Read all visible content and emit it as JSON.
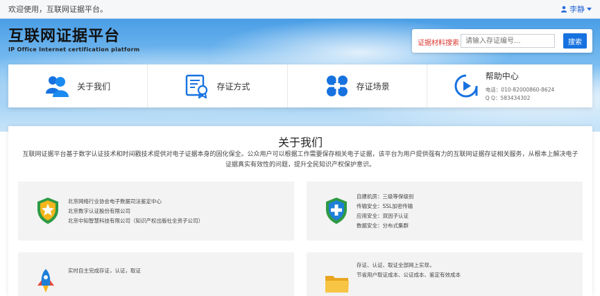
{
  "topbar": {
    "welcome": "欢迎使用，互联网证据平台。",
    "username": "李静",
    "user_icon": "user-icon",
    "caret_icon": "caret-down-icon"
  },
  "logo": {
    "title": "互联网证据平台",
    "subtitle": "IP Office Internet certification platform"
  },
  "search": {
    "label": "证据材料搜索：",
    "placeholder": "请输入存证编号...",
    "button": "搜索"
  },
  "nav": {
    "items": [
      {
        "label": "关于我们",
        "icon": "users-icon"
      },
      {
        "label": "存证方式",
        "icon": "certificate-icon"
      },
      {
        "label": "存证场景",
        "icon": "grid-icon"
      }
    ],
    "help": {
      "title": "帮助中心",
      "phone": "电话：010-82000860-8624",
      "qq": "Q  Q：583434302",
      "icon": "play-icon"
    }
  },
  "about": {
    "title": "关于我们",
    "description": "互联网证据平台基于数字认证技术和时间戳技术提供对电子证据本身的固化保全。公众用户可以根据工作需要保存相关电子证据，该平台为用户提供强有力的互联网证据存证相关服务，从根本上解决电子证据真实有效性的问题，提升全民知识产权保护意识。",
    "cards": [
      {
        "icon": "shield-star-icon",
        "lines": [
          "北京网络行业协会电子数据司法鉴定中心",
          "北京数字认证股份有限公司",
          "北京中知智慧科技有限公司（知识产权出版社全资子公司）"
        ]
      },
      {
        "icon": "shield-plus-icon",
        "lines": [
          "自建机房：三级等保级别",
          "传输安全：SSL加密传输",
          "应用安全：双因子认证",
          "数据安全：分布式集群"
        ]
      },
      {
        "icon": "rocket-icon",
        "lines": [
          "实时自主完成存证，认证，取证"
        ]
      },
      {
        "icon": "folder-icon",
        "lines": [
          "存证、认证、取证全部网上实现，",
          "节省用户取证成本、公证成本、鉴定有效成本"
        ]
      }
    ]
  },
  "colors": {
    "accent": "#1772e0",
    "label_red": "#d9362f"
  }
}
